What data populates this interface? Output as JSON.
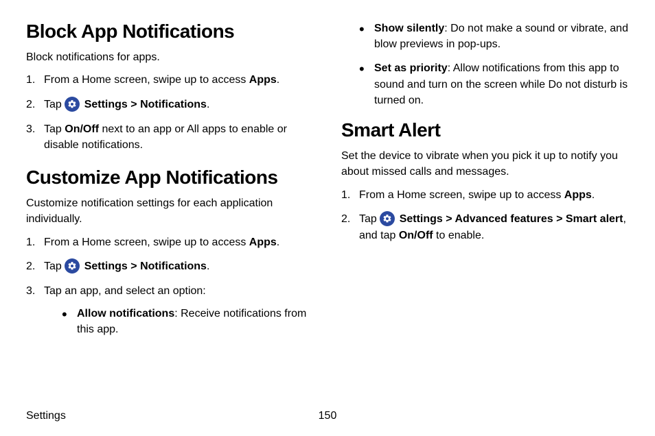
{
  "footer": {
    "label": "Settings",
    "page": "150"
  },
  "icon_color": "#2b4aa0",
  "left": {
    "section1": {
      "heading": "Block App Notifications",
      "intro": "Block notifications for apps.",
      "steps": {
        "s1_pre": "From a Home screen, swipe up to access ",
        "s1_bold": "Apps",
        "s1_post": ".",
        "s2_pre": "Tap ",
        "s2_b1": "Settings",
        "s2_sep": " > ",
        "s2_b2": "Notifications",
        "s2_post": ".",
        "s3_pre": "Tap ",
        "s3_b": "On/Off",
        "s3_post": " next to an app or All apps to enable or disable notifications."
      }
    },
    "section2": {
      "heading": "Customize App Notifications",
      "intro": "Customize notification settings for each application individually.",
      "steps": {
        "s1_pre": "From a Home screen, swipe up to access ",
        "s1_bold": "Apps",
        "s1_post": ".",
        "s2_pre": "Tap ",
        "s2_b1": "Settings",
        "s2_sep": " > ",
        "s2_b2": "Notifications",
        "s2_post": ".",
        "s3": "Tap an app, and select an option:",
        "bullet1_b": "Allow notifications",
        "bullet1_rest": ": Receive notifications from this app."
      }
    }
  },
  "right": {
    "bullets": {
      "b1_bold": "Show silently",
      "b1_rest": ": Do not make a sound or vibrate, and blow previews in pop-ups.",
      "b2_bold": "Set as priority",
      "b2_rest": ": Allow notifications from this app to sound and turn on the screen while Do not disturb is turned on."
    },
    "section3": {
      "heading": "Smart Alert",
      "intro": "Set the device to vibrate when you pick it up to notify you about missed calls and messages.",
      "steps": {
        "s1_pre": "From a Home screen, swipe up to access ",
        "s1_bold": "Apps",
        "s1_post": ".",
        "s2_pre": "Tap ",
        "s2_b1": "Settings",
        "s2_sep1": " > ",
        "s2_b2": "Advanced features",
        "s2_sep2": " > ",
        "s2_b3": "Smart alert",
        "s2_mid": ", and tap ",
        "s2_b4": "On/Off",
        "s2_post": " to enable."
      }
    }
  }
}
